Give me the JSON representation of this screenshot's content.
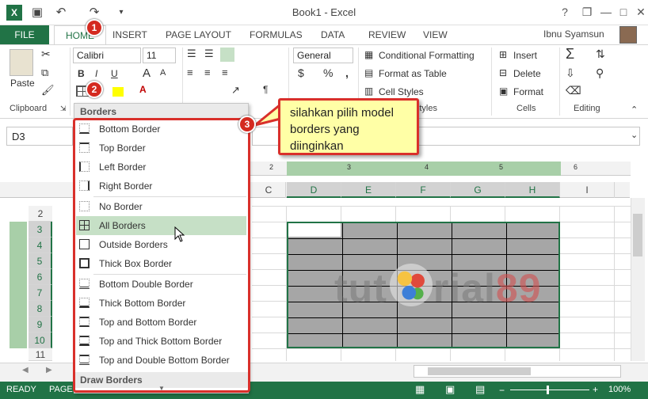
{
  "window": {
    "title": "Book1 - Excel",
    "help": "?",
    "restore_down": "❐",
    "minimize": "—",
    "maximize": "□",
    "close": "✕"
  },
  "qat": {
    "save_icon": "save-icon",
    "undo_icon": "undo-icon",
    "redo_icon": "redo-icon",
    "customize_icon": "customize-qat-icon"
  },
  "tabs": [
    "FILE",
    "HOME",
    "INSERT",
    "PAGE LAYOUT",
    "FORMULAS",
    "DATA",
    "REVIEW",
    "VIEW"
  ],
  "user": {
    "name": "Ibnu Syamsun"
  },
  "ribbon": {
    "clipboard": {
      "label": "Clipboard",
      "paste": "Paste"
    },
    "font": {
      "name": "Calibri",
      "size": "11",
      "bold": "B",
      "italic": "I",
      "underline": "U",
      "grow": "A",
      "shrink": "A"
    },
    "number": {
      "format": "General",
      "currency": "$",
      "percent": "%",
      "comma": ","
    },
    "styles": {
      "label": "Styles",
      "conditional": "Conditional Formatting",
      "table": "Format as Table",
      "cell": "Cell Styles"
    },
    "cells": {
      "label": "Cells",
      "insert": "Insert",
      "delete": "Delete",
      "format": "Format"
    },
    "editing": {
      "label": "Editing"
    }
  },
  "namebox": {
    "value": "D3"
  },
  "columns": [
    "C",
    "D",
    "E",
    "F",
    "G",
    "H",
    "I"
  ],
  "rows": [
    "2",
    "3",
    "4",
    "5",
    "6",
    "7",
    "8",
    "9",
    "10",
    "11"
  ],
  "ruler": {
    "marks": [
      "2",
      "3",
      "4",
      "5",
      "6"
    ]
  },
  "borders_menu": {
    "header": "Borders",
    "items": [
      "Bottom Border",
      "Top Border",
      "Left Border",
      "Right Border",
      "No Border",
      "All Borders",
      "Outside Borders",
      "Thick Box Border",
      "Bottom Double Border",
      "Thick Bottom Border",
      "Top and Bottom Border",
      "Top and Thick Bottom Border",
      "Top and Double Bottom Border"
    ],
    "highlighted": "All Borders",
    "footer": "Draw Borders"
  },
  "callout": {
    "text": "silahkan pilih model borders yang diinginkan"
  },
  "badges": [
    "1",
    "2",
    "3"
  ],
  "watermark": {
    "left": "tut",
    "mid": "rial",
    "num": "89"
  },
  "statusbar": {
    "ready": "READY",
    "page": "PAGE:",
    "zoom": "100%"
  },
  "colors": {
    "accent": "#217346",
    "callout_border": "#d9302b",
    "callout_fill": "#ffffa6",
    "badge": "#d42a20"
  }
}
